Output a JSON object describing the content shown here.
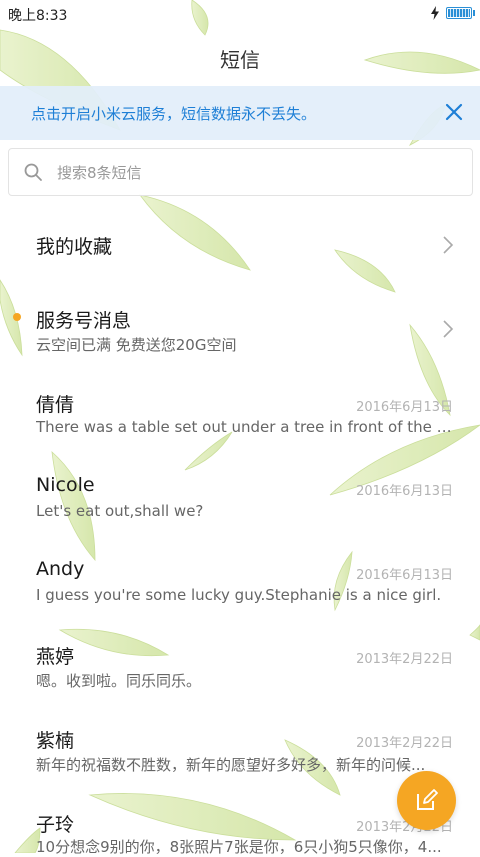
{
  "status_bar": {
    "time": "晚上8:33",
    "battery_level": 1.0
  },
  "header": {
    "title": "短信"
  },
  "banner": {
    "text": "点击开启小米云服务，短信数据永不丢失。"
  },
  "search": {
    "placeholder": "搜索8条短信",
    "value": ""
  },
  "favorites": {
    "label": "我的收藏"
  },
  "service_messages": {
    "name": "服务号消息",
    "preview": "云空间已满 免费送您20G空间"
  },
  "conversations": [
    {
      "name": "倩倩",
      "date": "2016年6月13日",
      "preview": "There was a table set out under a tree in front of the ho..."
    },
    {
      "name": "Nicole",
      "date": "2016年6月13日",
      "preview": "Let's eat out,shall we?"
    },
    {
      "name": "Andy",
      "date": "2016年6月13日",
      "preview": "I guess you're some lucky guy.Stephanie is a nice girl."
    },
    {
      "name": "燕婷",
      "date": "2013年2月22日",
      "preview": "嗯。收到啦。同乐同乐。"
    },
    {
      "name": "紫楠",
      "date": "2013年2月22日",
      "preview": "新年的祝福数不胜数，新年的愿望好多好多，新年的问候..."
    },
    {
      "name": "子玲",
      "date": "2013年2月22日",
      "preview": "10分想念9别的你，8张照片7张是你，6只小狗5只像你，4..."
    }
  ],
  "icons": {
    "status": "flash-icon",
    "banner_close": "close-icon",
    "search": "search-icon",
    "chevron": "chevron-right-icon",
    "fab": "compose-icon"
  },
  "colors": {
    "accent": "#1e7fd6",
    "fab": "#f5a623",
    "unread_dot": "#f5a623",
    "leaf": "#d7e8a8"
  }
}
